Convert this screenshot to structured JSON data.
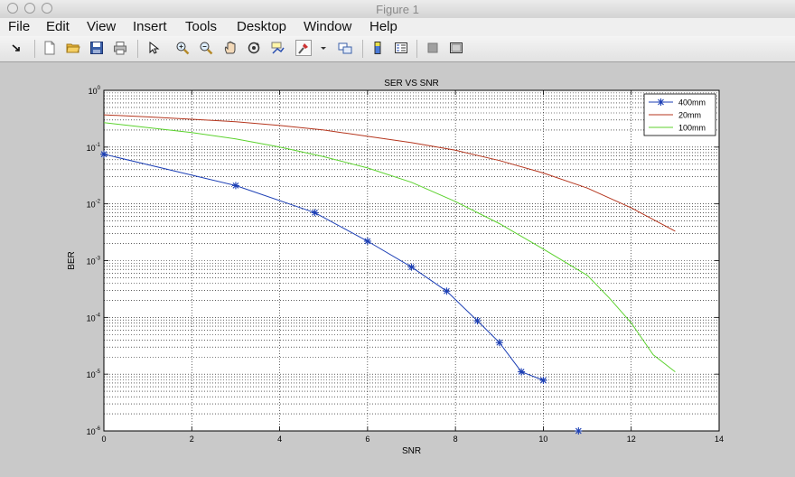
{
  "window": {
    "title": "Figure 1"
  },
  "menu": [
    "File",
    "Edit",
    "View",
    "Insert",
    "Tools",
    "Desktop",
    "Window",
    "Help"
  ],
  "toolbar": [
    "dock-arrow-icon",
    "new-figure-icon",
    "open-file-icon",
    "save-icon",
    "print-icon",
    "edit-plot-icon",
    "zoom-in-icon",
    "zoom-out-icon",
    "pan-icon",
    "rotate-3d-icon",
    "data-cursor-icon",
    "brush-icon",
    "brush-dropdown-icon",
    "link-plot-icon",
    "insert-colorbar-icon",
    "insert-legend-icon",
    "hide-plot-tools-icon",
    "show-plot-tools-icon"
  ],
  "chart_data": {
    "type": "line",
    "title": "SER VS SNR",
    "xlabel": "SNR",
    "ylabel": "BER",
    "xlim": [
      0,
      14
    ],
    "ylim": [
      1e-06,
      1
    ],
    "yscale": "log",
    "grid": true,
    "legend_position": "top-right",
    "x_ticks": [
      "0",
      "2",
      "4",
      "6",
      "8",
      "10",
      "12",
      "14"
    ],
    "y_ticks": [
      {
        "base": "10",
        "exp": "-6",
        "value": 1e-06
      },
      {
        "base": "10",
        "exp": "-5",
        "value": 1e-05
      },
      {
        "base": "10",
        "exp": "-4",
        "value": 0.0001
      },
      {
        "base": "10",
        "exp": "-3",
        "value": 0.001
      },
      {
        "base": "10",
        "exp": "-2",
        "value": 0.01
      },
      {
        "base": "10",
        "exp": "-1",
        "value": 0.1
      },
      {
        "base": "10",
        "exp": "0",
        "value": 1
      }
    ],
    "series": [
      {
        "name": "400mm",
        "color": "#1c3fb5",
        "marker": "*",
        "x": [
          0,
          3.0,
          4.8,
          6.0,
          7.0,
          7.8,
          8.5,
          9.0,
          9.5,
          10.0,
          10.8
        ],
        "y": [
          0.075,
          0.021,
          0.007,
          0.0022,
          0.00077,
          0.00029,
          8.7e-05,
          3.6e-05,
          1.1e-05,
          7.8e-06,
          1e-06
        ]
      },
      {
        "name": "20mm",
        "color": "#b5361e",
        "marker": "",
        "x": [
          0,
          1,
          2,
          3,
          4,
          5,
          6,
          7,
          8,
          9,
          10,
          11,
          12,
          13
        ],
        "y": [
          0.37,
          0.34,
          0.31,
          0.28,
          0.24,
          0.2,
          0.155,
          0.12,
          0.088,
          0.058,
          0.035,
          0.019,
          0.0085,
          0.0033
        ]
      },
      {
        "name": "100mm",
        "color": "#5cd22e",
        "marker": "",
        "x": [
          0,
          1,
          2,
          3,
          4,
          5,
          6,
          7,
          8,
          9,
          10,
          11,
          11.5,
          12,
          12.5,
          13
        ],
        "y": [
          0.27,
          0.22,
          0.18,
          0.14,
          0.1,
          0.068,
          0.043,
          0.024,
          0.011,
          0.0045,
          0.0016,
          0.00055,
          0.00022,
          8e-05,
          2.2e-05,
          1.1e-05
        ]
      }
    ]
  }
}
